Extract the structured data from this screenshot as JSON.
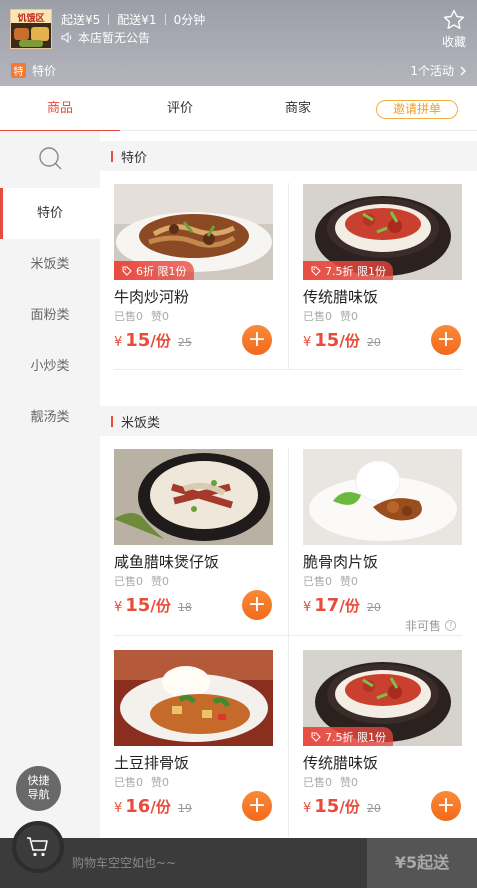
{
  "shop": {
    "logo_text": "饥饿区",
    "min_order": "起送¥5",
    "delivery_fee": "配送¥1",
    "delivery_time": "0分钟",
    "notice": "本店暂无公告",
    "favorite_label": "收藏",
    "promo_badge": "特",
    "promo_text": "特价",
    "promo_count": "1个活动"
  },
  "tabs": [
    {
      "label": "商品",
      "active": true
    },
    {
      "label": "评价",
      "active": false
    },
    {
      "label": "商家",
      "active": false
    }
  ],
  "invite_button": "邀请拼单",
  "sidebar": {
    "search_icon": "search-icon",
    "items": [
      {
        "label": "特价",
        "active": true
      },
      {
        "label": "米饭类",
        "active": false
      },
      {
        "label": "面粉类",
        "active": false
      },
      {
        "label": "小炒类",
        "active": false
      },
      {
        "label": "靓汤类",
        "active": false
      }
    ]
  },
  "sections": [
    {
      "title": "特价",
      "products": [
        {
          "name": "牛肉炒河粉",
          "sold": "已售0",
          "likes": "赞0",
          "currency": "¥",
          "price": "15",
          "unit": "/份",
          "original_price": "25",
          "discount": "6折 限1份",
          "add": "+"
        },
        {
          "name": "传统腊味饭",
          "sold": "已售0",
          "likes": "赞0",
          "currency": "¥",
          "price": "15",
          "unit": "/份",
          "original_price": "20",
          "discount": "7.5折 限1份",
          "add": "+"
        }
      ]
    },
    {
      "title": "米饭类",
      "products": [
        {
          "name": "咸鱼腊味煲仔饭",
          "sold": "已售0",
          "likes": "赞0",
          "currency": "¥",
          "price": "15",
          "unit": "/份",
          "original_price": "18",
          "add": "+"
        },
        {
          "name": "脆骨肉片饭",
          "sold": "已售0",
          "likes": "赞0",
          "currency": "¥",
          "price": "17",
          "unit": "/份",
          "original_price": "20",
          "unavailable": "非可售",
          "unavailable_help": "?"
        },
        {
          "name": "土豆排骨饭",
          "sold": "已售0",
          "likes": "赞0",
          "currency": "¥",
          "price": "16",
          "unit": "/份",
          "original_price": "19",
          "add": "+"
        },
        {
          "name": "传统腊味饭",
          "sold": "已售0",
          "likes": "赞0",
          "currency": "¥",
          "price": "15",
          "unit": "/份",
          "original_price": "20",
          "discount": "7.5折 限1份",
          "add": "+"
        }
      ]
    }
  ],
  "quick_nav": {
    "line1": "快捷",
    "line2": "导航"
  },
  "cart": {
    "empty_text": "购物车空空如也~~",
    "checkout_label": "¥5起送"
  },
  "colors": {
    "accent": "#e74c3c",
    "add_button": "#f26a1b",
    "invite": "#f0a020"
  }
}
